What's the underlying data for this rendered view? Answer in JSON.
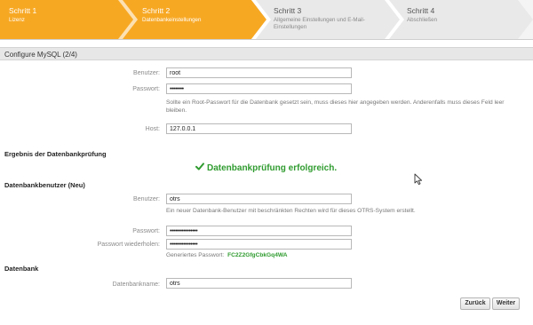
{
  "wizard": {
    "steps": [
      {
        "title": "Schritt 1",
        "subtitle": "Lizenz",
        "state": "done"
      },
      {
        "title": "Schritt 2",
        "subtitle": "Datenbankeinstellungen",
        "state": "done"
      },
      {
        "title": "Schritt 3",
        "subtitle": "Allgemeine Einstellungen und E-Mail-Einstellungen",
        "state": "todo"
      },
      {
        "title": "Schritt 4",
        "subtitle": "Abschließen",
        "state": "todo"
      }
    ],
    "colors": {
      "done": "#f7a823",
      "todo": "#e9e9e9"
    }
  },
  "section": {
    "title": "Configure MySQL (2/4)"
  },
  "db_login": {
    "user_label": "Benutzer:",
    "user_value": "root",
    "password_label": "Passwort:",
    "password_value": "••••••••",
    "password_hint": "Sollte ein Root-Passwort für die Datenbank gesetzt sein, muss dieses hier angegeben werden. Anderenfalls muss dieses Feld leer bleiben.",
    "host_label": "Host:",
    "host_value": "127.0.0.1"
  },
  "check": {
    "heading": "Ergebnis der Datenbankprüfung",
    "result": "Datenbankprüfung erfolgreich.",
    "color": "#2f9b2f"
  },
  "new_user": {
    "heading": "Datenbankbenutzer (Neu)",
    "user_label": "Benutzer:",
    "user_value": "otrs",
    "user_hint": "Ein neuer Datenbank-Benutzer mit beschränkten Rechten wird für dieses OTRS-System erstellt.",
    "password_label": "Passwort:",
    "password_value": "••••••••••••••••",
    "password_repeat_label": "Passwort wiederholen:",
    "password_repeat_value": "••••••••••••••••",
    "generated_label": "Generiertes Passwort:",
    "generated_value": "FC2Z2GfgCbkGq4WA"
  },
  "database": {
    "heading": "Datenbank",
    "name_label": "Datenbankname:",
    "name_value": "otrs"
  },
  "buttons": {
    "back": "Zurück",
    "next": "Weiter"
  }
}
